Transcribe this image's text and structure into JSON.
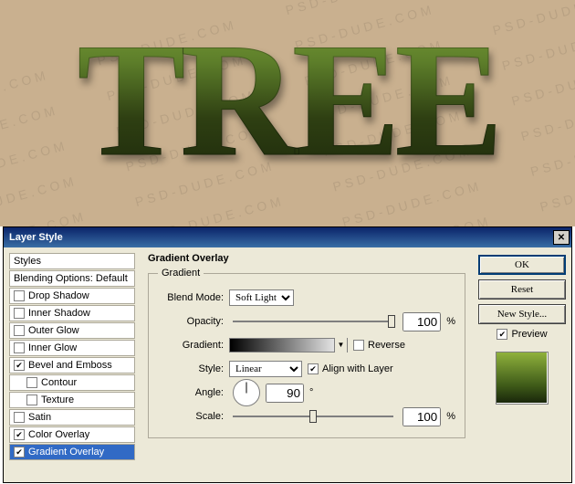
{
  "canvas": {
    "text": "TREE",
    "watermark": "PSD-DUDE.COM  PSD-DUDE.COM  PSD-DUDE.COM  PSD-DUDE.COM\nPSD-DUDE.COM  PSD-DUDE.COM  PSD-DUDE.COM  PSD-DUDE.COM\nPSD-DUDE.COM  PSD-DUDE.COM  PSD-DUDE.COM  PSD-DUDE.COM\nPSD-DUDE.COM  PSD-DUDE.COM  PSD-DUDE.COM  PSD-DUDE.COM\nPSD-DUDE.COM  PSD-DUDE.COM  PSD-DUDE.COM  PSD-DUDE.COM\nPSD-DUDE.COM  PSD-DUDE.COM  PSD-DUDE.COM  PSD-DUDE.COM\nPSD-DUDE.COM  PSD-DUDE.COM  PSD-DUDE.COM  PSD-DUDE.COM\nPSD-DUDE.COM  PSD-DUDE.COM  PSD-DUDE.COM  PSD-DUDE.COM"
  },
  "dialog": {
    "title": "Layer Style",
    "sidebar": {
      "styles": "Styles",
      "blending": "Blending Options: Default",
      "drop": "Drop Shadow",
      "innerShadow": "Inner Shadow",
      "outerGlow": "Outer Glow",
      "innerGlow": "Inner Glow",
      "bevel": "Bevel and Emboss",
      "contour": "Contour",
      "texture": "Texture",
      "satin": "Satin",
      "colorOverlay": "Color Overlay",
      "gradientOverlay": "Gradient Overlay"
    },
    "section": {
      "title": "Gradient Overlay",
      "legend": "Gradient",
      "blendModeLabel": "Blend Mode:",
      "blendMode": "Soft Light",
      "opacityLabel": "Opacity:",
      "opacity": "100",
      "pct": "%",
      "gradientLabel": "Gradient:",
      "reverse": "Reverse",
      "styleLabel": "Style:",
      "style": "Linear",
      "align": "Align with Layer",
      "angleLabel": "Angle:",
      "angle": "90",
      "deg": "°",
      "scaleLabel": "Scale:",
      "scale": "100"
    },
    "buttons": {
      "ok": "OK",
      "reset": "Reset",
      "newStyle": "New Style...",
      "preview": "Preview"
    }
  }
}
